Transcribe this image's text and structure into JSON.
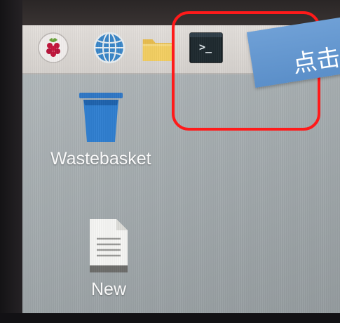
{
  "taskbar": {
    "icons": [
      {
        "name": "raspberry-pi-menu-icon"
      },
      {
        "name": "web-browser-globe-icon"
      },
      {
        "name": "file-manager-folder-icon"
      },
      {
        "name": "terminal-icon",
        "glyph": ">_"
      }
    ]
  },
  "desktop": {
    "items": [
      {
        "label": "Wastebasket",
        "icon": "wastebasket-icon"
      },
      {
        "label": "New",
        "icon": "document-icon"
      }
    ]
  },
  "annotation": {
    "callout_text": "点击",
    "highlight_color": "#ff1a1a",
    "callout_color": "#5b8fc9"
  }
}
